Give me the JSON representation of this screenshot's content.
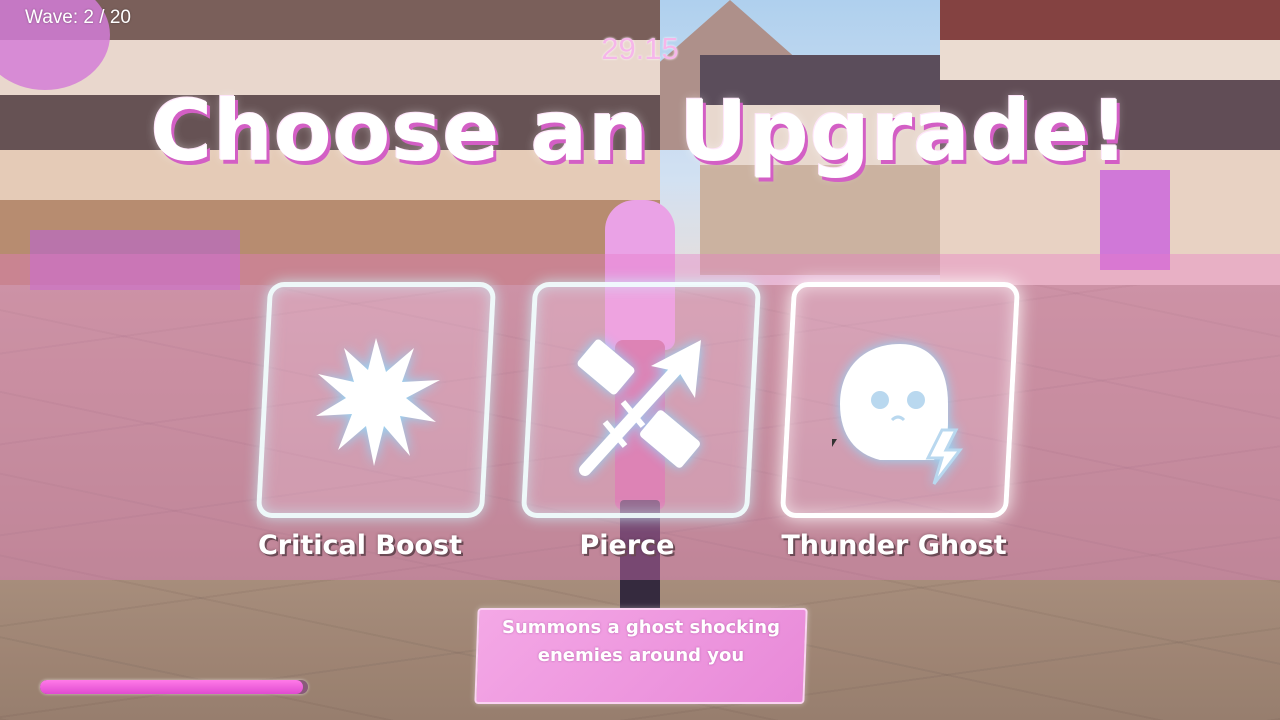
{
  "hud": {
    "wave_label": "Wave: 2 / 20",
    "timer": "29.15",
    "progress_fraction": 0.98
  },
  "title": "Choose an Upgrade!",
  "upgrades": [
    {
      "label": "Critical Boost",
      "icon": "burst-icon",
      "selected": false
    },
    {
      "label": "Pierce",
      "icon": "piercing-arrow-icon",
      "selected": false
    },
    {
      "label": "Thunder Ghost",
      "icon": "ghost-lightning-icon",
      "selected": true
    }
  ],
  "description": {
    "line1": "Summons a ghost shocking",
    "line2": "enemies around you"
  },
  "colors": {
    "accent_pink": "#e889d8",
    "title_shadow": "#d35fc5",
    "icon_glow": "#8cdcff"
  }
}
